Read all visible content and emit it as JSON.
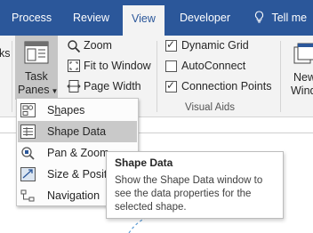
{
  "tabs": [
    "Process",
    "Review",
    "View",
    "Developer"
  ],
  "active_tab": "View",
  "tell_me": "Tell me",
  "ribbon": {
    "left_cut_label": "ks",
    "task_panes": {
      "line1": "Task",
      "line2": "Panes"
    },
    "zoom": "Zoom",
    "fit_to_window": "Fit to Window",
    "page_width": "Page Width",
    "checks": [
      {
        "label": "Dynamic Grid",
        "checked": true
      },
      {
        "label": "AutoConnect",
        "checked": false
      },
      {
        "label": "Connection Points",
        "checked": true
      }
    ],
    "visual_aids_label": "Visual Aids",
    "new_window": {
      "line1": "New",
      "line2": "Windo"
    }
  },
  "menu": {
    "items": [
      {
        "label": "Shapes",
        "underline": "h",
        "rest_before": "S",
        "rest_after": "apes",
        "icon": "shapes-window-icon"
      },
      {
        "label": "Shape Data",
        "highlighted": true,
        "icon": "shape-data-icon"
      },
      {
        "label": "Pan & Zoom",
        "icon": "pan-zoom-icon"
      },
      {
        "label": "Size & Positi",
        "icon": "size-position-icon"
      },
      {
        "label": "Navigation",
        "icon": "navigation-icon"
      }
    ]
  },
  "tooltip": {
    "title": "Shape Data",
    "body": "Show the Shape Data window to see the data properties for the selected shape."
  },
  "colors": {
    "tab_bar": "#2b579a",
    "ribbon": "#f3f3f3",
    "highlight": "#c9c9c9"
  }
}
